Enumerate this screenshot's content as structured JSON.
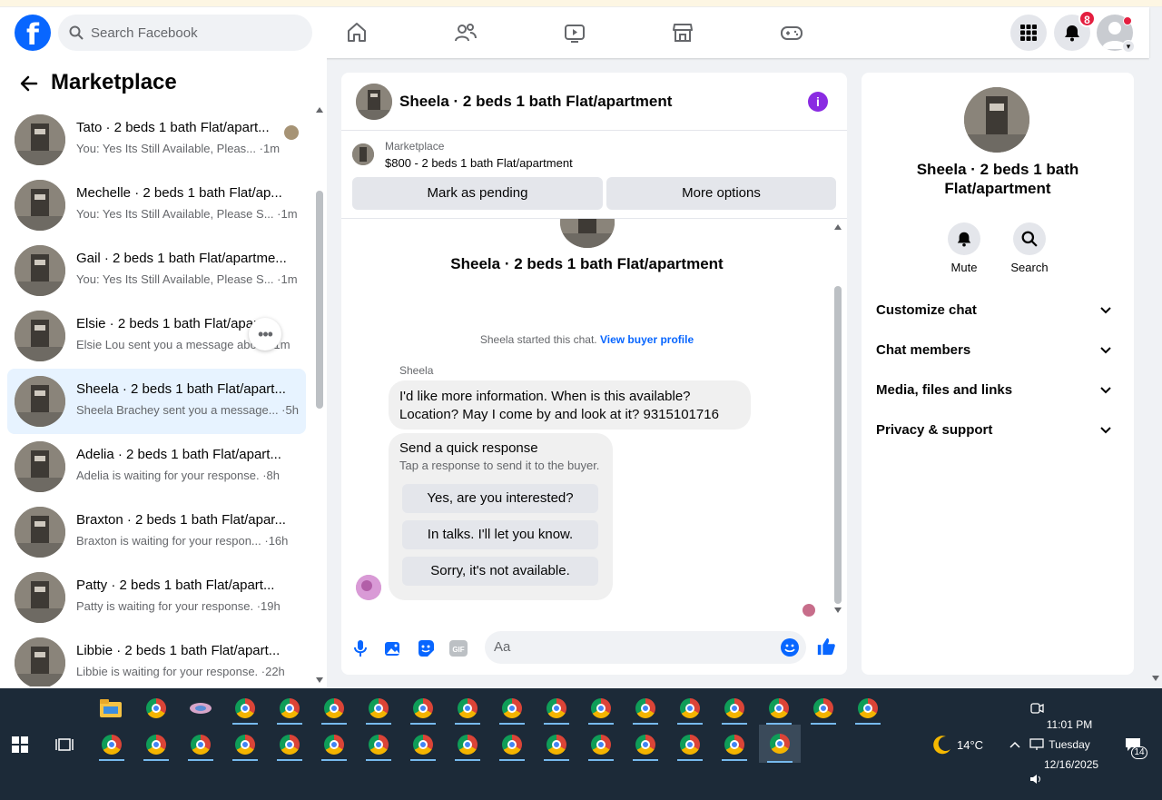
{
  "header": {
    "search_placeholder": "Search Facebook",
    "notifications_count": "8"
  },
  "left": {
    "title": "Marketplace",
    "conversations": [
      {
        "title": "Tato · 2 beds 1 bath Flat/apart...",
        "subtitle": "You: Yes Its Still Available, Pleas... ·1m"
      },
      {
        "title": "Mechelle · 2 beds 1 bath Flat/ap...",
        "subtitle": "You: Yes Its Still Available, Please S... ·1m"
      },
      {
        "title": "Gail · 2 beds 1 bath Flat/apartme...",
        "subtitle": "You: Yes Its Still Available, Please S... ·1m"
      },
      {
        "title": "Elsie · 2 beds 1 bath Flat/apar...",
        "subtitle": "Elsie Lou sent you a message abo... ·1m"
      },
      {
        "title": "Sheela · 2 beds 1 bath Flat/apart...",
        "subtitle": "Sheela Brachey sent you a message... ·5h"
      },
      {
        "title": "Adelia · 2 beds 1 bath Flat/apart...",
        "subtitle": "Adelia is waiting for your response. ·8h"
      },
      {
        "title": "Braxton · 2 beds 1 bath Flat/apar...",
        "subtitle": "Braxton is waiting for your respon... ·16h"
      },
      {
        "title": "Patty · 2 beds 1 bath Flat/apart...",
        "subtitle": "Patty is waiting for your response. ·19h"
      },
      {
        "title": "Libbie · 2 beds 1 bath Flat/apart...",
        "subtitle": "Libbie is waiting for your response. ·22h"
      }
    ]
  },
  "chat": {
    "title": "Sheela · 2 beds 1 bath Flat/apartment",
    "marketplace_label": "Marketplace",
    "listing": "$800 - 2 beds 1 bath Flat/apartment",
    "mark_pending": "Mark as pending",
    "more_options": "More options",
    "started_text": "Sheela started this chat.",
    "view_profile": "View buyer profile",
    "sender": "Sheela",
    "message_line1": "I'd like more information. When is this available?",
    "message_line2": "Location? May I come by and look at it? 9315101716",
    "quick_title": "Send a quick response",
    "quick_subtitle": "Tap a response to send it to the buyer.",
    "quick_responses": [
      "Yes, are you interested?",
      "In talks. I'll let you know.",
      "Sorry, it's not available."
    ],
    "input_placeholder": "Aa"
  },
  "details": {
    "title": "Sheela · 2 beds 1 bath Flat/apartment",
    "mute": "Mute",
    "search": "Search",
    "sections": [
      "Customize chat",
      "Chat members",
      "Media, files and links",
      "Privacy & support"
    ]
  },
  "taskbar": {
    "weather": "14°C",
    "time": "11:01 PM",
    "day": "Tuesday",
    "date": "12/16/2025",
    "notif_count": "14"
  }
}
